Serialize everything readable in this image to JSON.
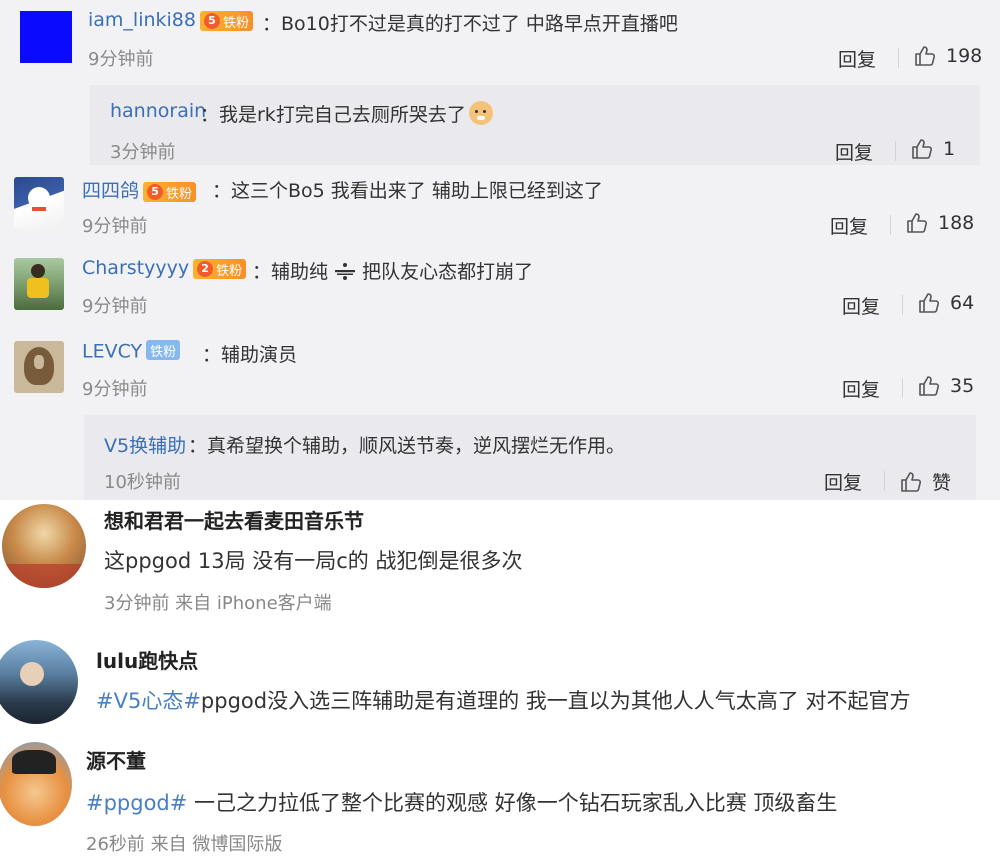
{
  "comments": [
    {
      "user": "iam_linki88",
      "level": "5",
      "badge": "铁粉",
      "text": "：Bo10打不过是真的打不过了 中路早点开直播吧",
      "time": "9分钟前",
      "reply": "回复",
      "likes": "198",
      "avatar_color": "#0a0aff"
    },
    {
      "user": "hannorain",
      "text": "：我是rk打完自己去厕所哭去了",
      "emoji": "doge-emoji",
      "time": "3分钟前",
      "reply": "回复",
      "likes": "1"
    },
    {
      "user": "四四鸽",
      "level": "5",
      "badge": "铁粉",
      "text": "：这三个Bo5 我看出来了 辅助上限已经到这了",
      "time": "9分钟前",
      "reply": "回复",
      "likes": "188"
    },
    {
      "user": "Charstyyyy",
      "level": "2",
      "badge": "铁粉",
      "text_a": "：辅助纯",
      "text_b": "把队友心态都打崩了",
      "time": "9分钟前",
      "reply": "回复",
      "likes": "64"
    },
    {
      "user": "LEVCY",
      "badge": "铁粉",
      "text": "：辅助演员",
      "time": "9分钟前",
      "reply": "回复",
      "likes": "35"
    },
    {
      "user": "V5换辅助",
      "text": "：真希望换个辅助，顺风送节奏，逆风摆烂无作用。",
      "time": "10秒钟前",
      "reply": "回复",
      "likes": "赞"
    }
  ],
  "posts": [
    {
      "user": "想和君君一起去看麦田音乐节",
      "text": "这ppgod 13局 没有一局c的 战犯倒是很多次",
      "meta": "3分钟前 来自 iPhone客户端"
    },
    {
      "user": "lulu跑快点",
      "topic": "#V5心态#",
      "text": "ppgod没入选三阵辅助是有道理的 我一直以为其他人人气太高了 对不起官方"
    },
    {
      "user": "源不董",
      "topic": "#ppgod#",
      "text": " 一己之力拉低了整个比赛的观感 好像一个钻石玩家乱入比赛 顶级畜生",
      "meta": "26秒前 来自 微博国际版"
    }
  ],
  "colors": {
    "link": "#3b6fb6",
    "topic": "#4a7fc1",
    "gray_bg": "#f2f2f5",
    "reply_bg": "#e9e9ee",
    "fan_orange": "#f6902a",
    "fan_blue": "#86b8f0"
  }
}
